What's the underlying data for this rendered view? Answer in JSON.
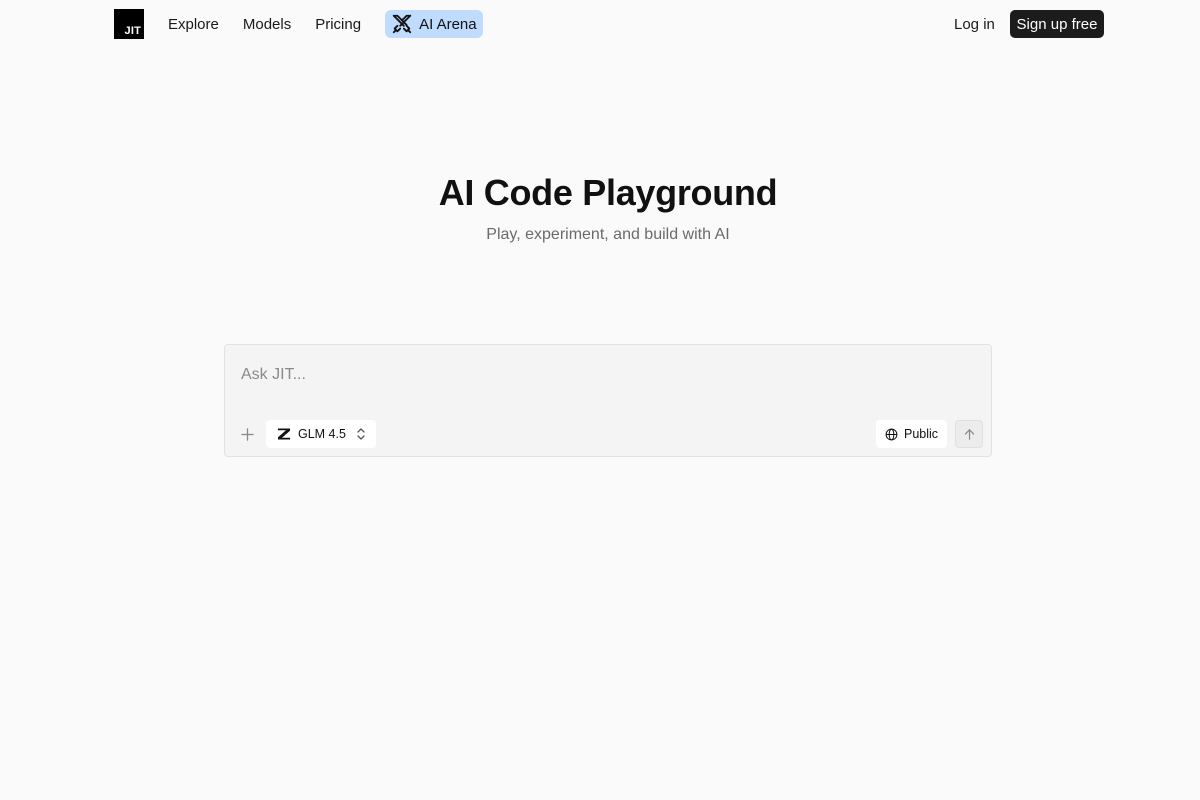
{
  "header": {
    "logo_text": "JIT",
    "nav": {
      "explore": "Explore",
      "models": "Models",
      "pricing": "Pricing",
      "arena": "AI Arena"
    },
    "login": "Log in",
    "signup": "Sign up free"
  },
  "hero": {
    "title": "AI Code Playground",
    "subtitle": "Play, experiment, and build with AI"
  },
  "prompt": {
    "placeholder": "Ask JIT...",
    "model": "GLM 4.5",
    "visibility": "Public"
  },
  "icons": {
    "add": "plus-icon",
    "model": "z-logo-icon",
    "chevron": "chevron-up-down-icon",
    "visibility": "globe-icon",
    "send": "arrow-up-icon",
    "arena": "crossed-swords-icon"
  },
  "colors": {
    "background": "#fafafa",
    "arena_highlight": "#bfdbfe",
    "signup_bg": "#1c1c1c",
    "prompt_bg": "#f4f4f4"
  }
}
